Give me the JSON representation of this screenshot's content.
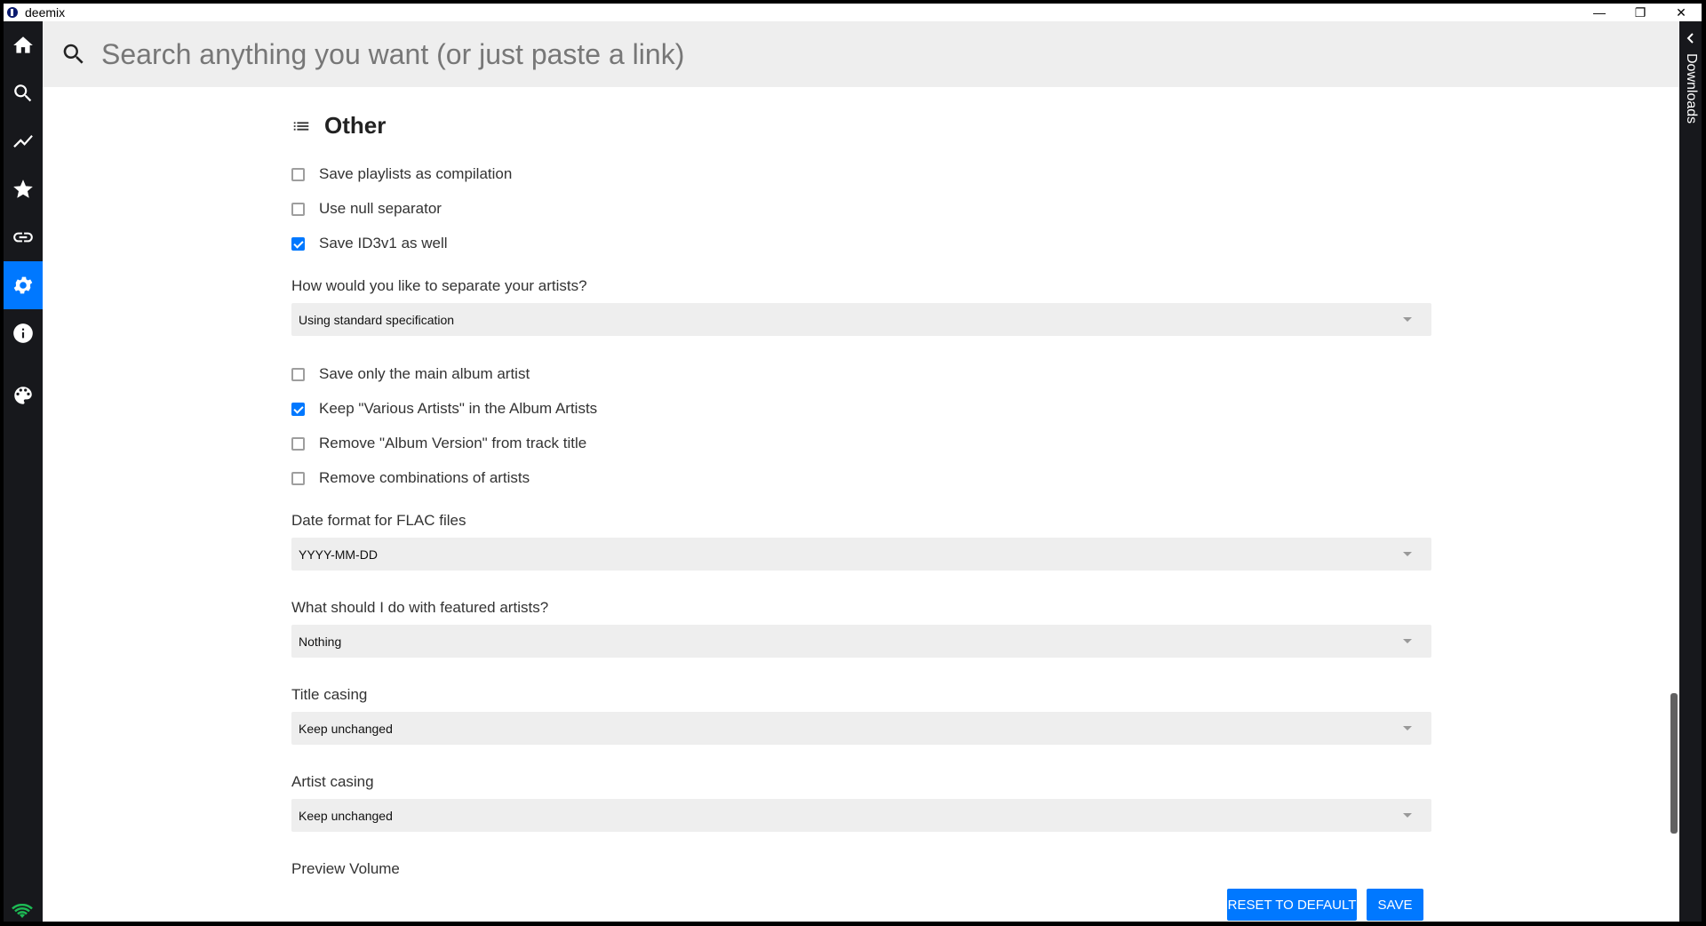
{
  "window": {
    "title": "deemix",
    "minimize": "—",
    "restore": "❐",
    "close": "✕"
  },
  "sidebar": {
    "items": [
      {
        "icon": "home-icon"
      },
      {
        "icon": "search-icon"
      },
      {
        "icon": "charts-icon"
      },
      {
        "icon": "favorites-icon"
      },
      {
        "icon": "link-icon"
      },
      {
        "icon": "settings-icon",
        "active": true
      },
      {
        "icon": "info-icon"
      },
      {
        "icon": "palette-icon"
      }
    ],
    "status_icon": "wifi-icon"
  },
  "search": {
    "placeholder": "Search anything you want (or just paste a link)"
  },
  "downloads": {
    "label": "Downloads"
  },
  "settings": {
    "section_title": "Other",
    "checkboxes_top": [
      {
        "label": "Save playlists as compilation",
        "checked": false
      },
      {
        "label": "Use null separator",
        "checked": false
      },
      {
        "label": "Save ID3v1 as well",
        "checked": true
      }
    ],
    "artist_separator": {
      "label": "How would you like to separate your artists?",
      "value": "Using standard specification"
    },
    "checkboxes_mid": [
      {
        "label": "Save only the main album artist",
        "checked": false
      },
      {
        "label": "Keep \"Various Artists\" in the Album Artists",
        "checked": true
      },
      {
        "label": "Remove \"Album Version\" from track title",
        "checked": false
      },
      {
        "label": "Remove combinations of artists",
        "checked": false
      }
    ],
    "date_format": {
      "label": "Date format for FLAC files",
      "value": "YYYY-MM-DD"
    },
    "featured_artists": {
      "label": "What should I do with featured artists?",
      "value": "Nothing"
    },
    "title_casing": {
      "label": "Title casing",
      "value": "Keep unchanged"
    },
    "artist_casing": {
      "label": "Artist casing",
      "value": "Keep unchanged"
    },
    "preview_volume_label": "Preview Volume"
  },
  "actions": {
    "reset_label": "RESET TO DEFAULT",
    "save_label": "SAVE"
  },
  "colors": {
    "accent": "#0078ff",
    "sidebar": "#17181c",
    "field_bg": "#eeeeee"
  }
}
